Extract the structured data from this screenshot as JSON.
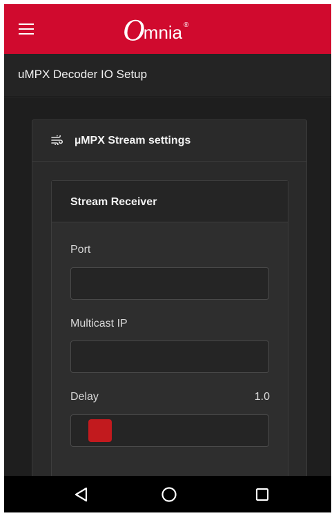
{
  "app": {
    "brand_initial": "O",
    "brand_rest": "mnia",
    "brand_mark": "®",
    "brand_color": "#d00a2e",
    "menu_icon": "hamburger-menu-icon"
  },
  "header": {
    "title": "uMPX Decoder IO Setup"
  },
  "section": {
    "title": "µMPX Stream settings",
    "icon": "wind-icon"
  },
  "stream_receiver": {
    "title": "Stream Receiver",
    "port": {
      "label": "Port",
      "value": ""
    },
    "multicast_ip": {
      "label": "Multicast IP",
      "value": ""
    },
    "delay": {
      "label": "Delay",
      "value": "1.0",
      "accent": "#c21a1e"
    }
  },
  "navigation": {
    "back_icon": "back-triangle-icon",
    "home_icon": "home-circle-icon",
    "recents_icon": "recents-square-icon"
  }
}
